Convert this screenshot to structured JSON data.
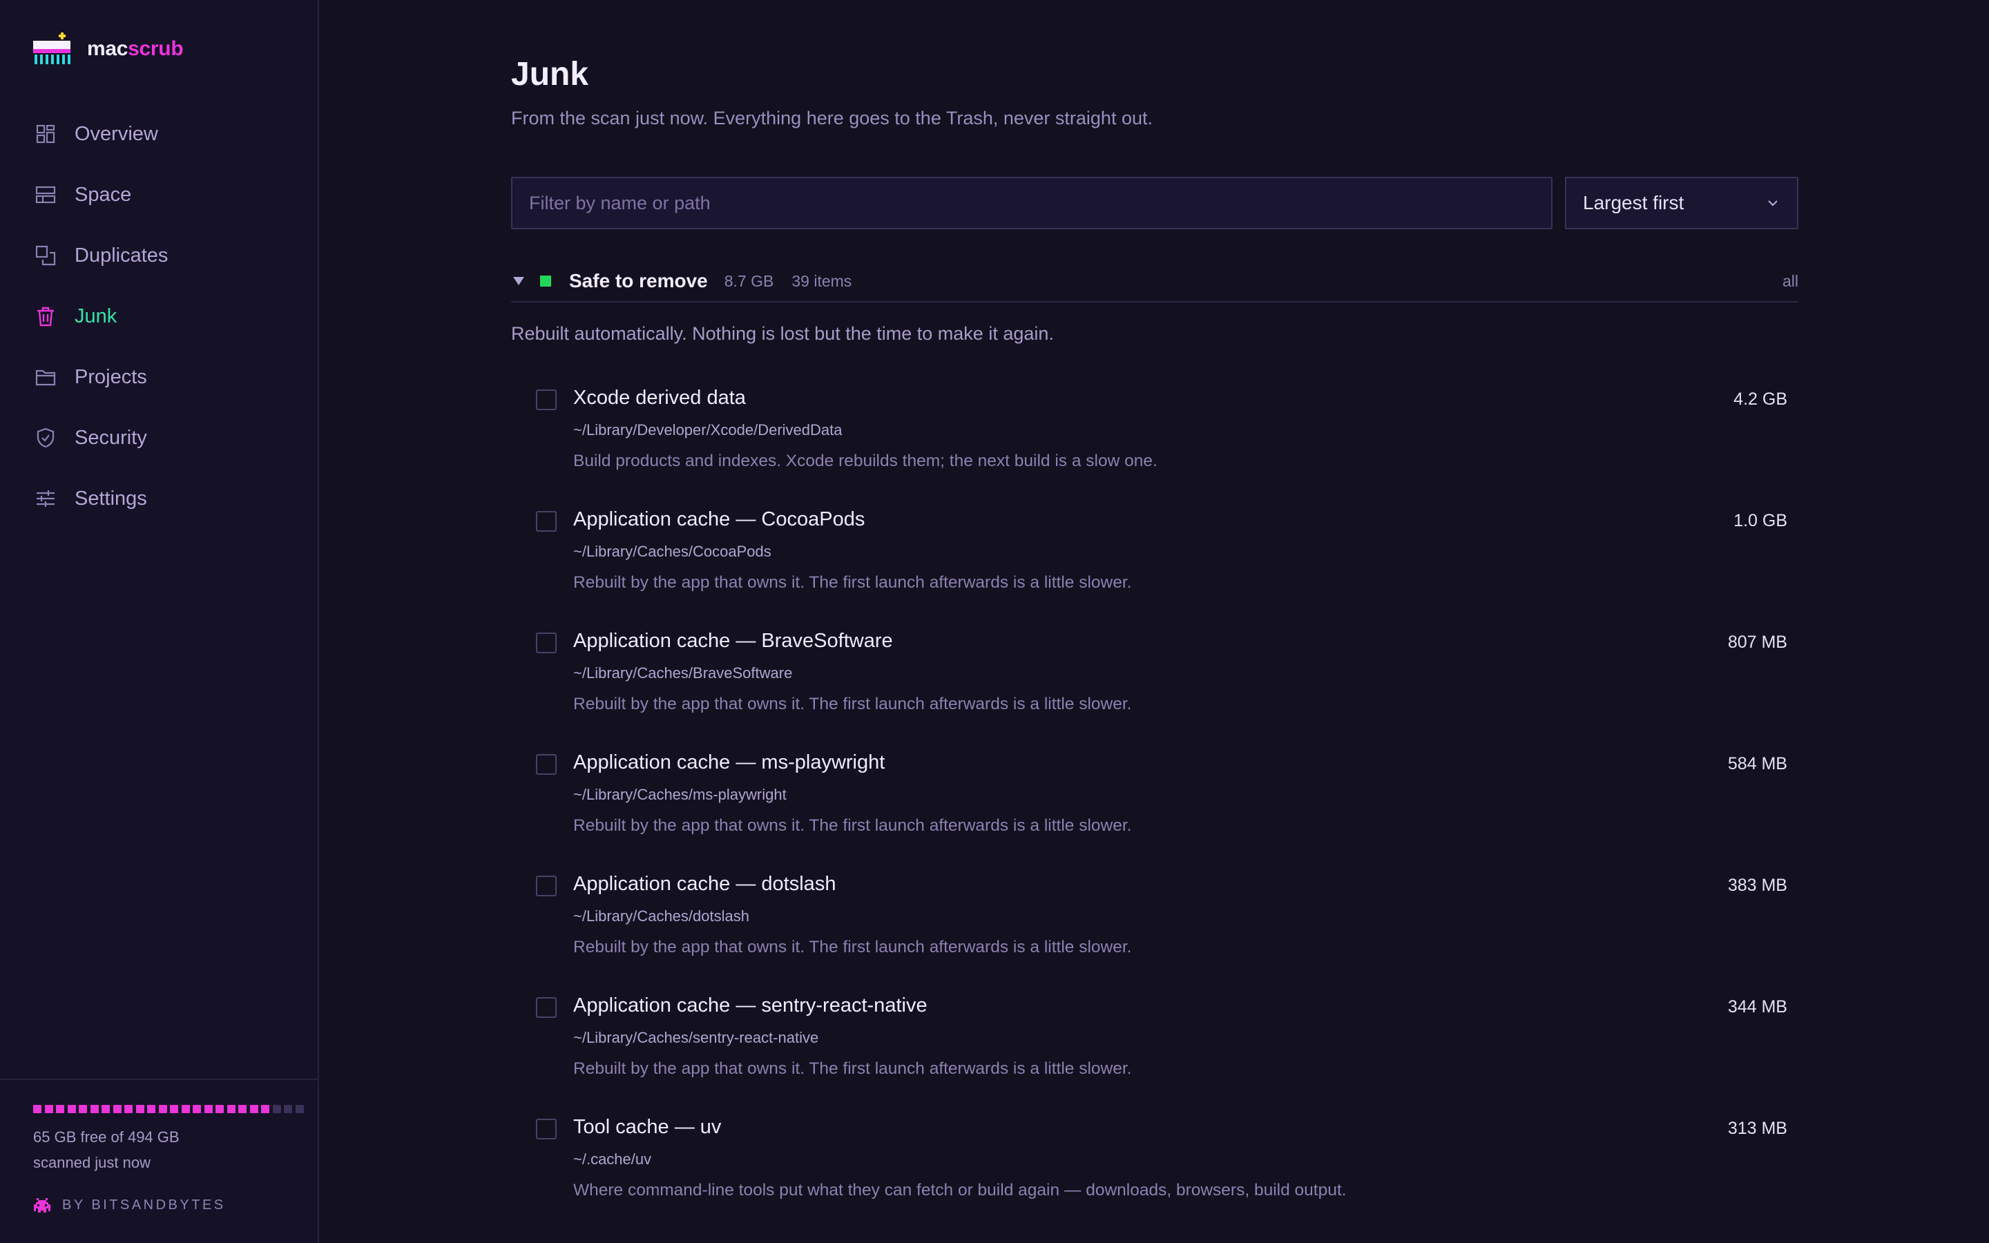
{
  "brand": {
    "mac": "mac",
    "scrub": "scrub"
  },
  "nav": [
    {
      "label": "Overview",
      "icon": "overview-icon",
      "active": false
    },
    {
      "label": "Space",
      "icon": "space-icon",
      "active": false
    },
    {
      "label": "Duplicates",
      "icon": "duplicates-icon",
      "active": false
    },
    {
      "label": "Junk",
      "icon": "trash-icon",
      "active": true
    },
    {
      "label": "Projects",
      "icon": "folder-icon",
      "active": false
    },
    {
      "label": "Security",
      "icon": "shield-icon",
      "active": false
    },
    {
      "label": "Settings",
      "icon": "sliders-icon",
      "active": false
    }
  ],
  "storage": {
    "free_line": "65 GB free of 494 GB",
    "scanned_line": "scanned just now",
    "used_fraction": 0.87
  },
  "byline": "BY BITSANDBYTES",
  "page": {
    "title": "Junk",
    "subtitle": "From the scan just now. Everything here goes to the Trash, never straight out."
  },
  "filter": {
    "placeholder": "Filter by name or path"
  },
  "sort": {
    "value": "Largest first"
  },
  "group": {
    "title": "Safe to remove",
    "size": "8.7 GB",
    "count": "39 items",
    "all_label": "all",
    "description": "Rebuilt automatically. Nothing is lost but the time to make it again."
  },
  "items": [
    {
      "name": "Xcode derived data",
      "path": "~/Library/Developer/Xcode/DerivedData",
      "note": "Build products and indexes. Xcode rebuilds them; the next build is a slow one.",
      "size": "4.2 GB"
    },
    {
      "name": "Application cache — CocoaPods",
      "path": "~/Library/Caches/CocoaPods",
      "note": "Rebuilt by the app that owns it. The first launch afterwards is a little slower.",
      "size": "1.0 GB"
    },
    {
      "name": "Application cache — BraveSoftware",
      "path": "~/Library/Caches/BraveSoftware",
      "note": "Rebuilt by the app that owns it. The first launch afterwards is a little slower.",
      "size": "807 MB"
    },
    {
      "name": "Application cache — ms-playwright",
      "path": "~/Library/Caches/ms-playwright",
      "note": "Rebuilt by the app that owns it. The first launch afterwards is a little slower.",
      "size": "584 MB"
    },
    {
      "name": "Application cache — dotslash",
      "path": "~/Library/Caches/dotslash",
      "note": "Rebuilt by the app that owns it. The first launch afterwards is a little slower.",
      "size": "383 MB"
    },
    {
      "name": "Application cache — sentry-react-native",
      "path": "~/Library/Caches/sentry-react-native",
      "note": "Rebuilt by the app that owns it. The first launch afterwards is a little slower.",
      "size": "344 MB"
    },
    {
      "name": "Tool cache — uv",
      "path": "~/.cache/uv",
      "note": "Where command-line tools put what they can fetch or build again — downloads, browsers, build output.",
      "size": "313 MB"
    }
  ],
  "colors": {
    "accent_pink": "#e935d9",
    "active_green": "#33e4a5",
    "safe_green": "#22d65a"
  }
}
